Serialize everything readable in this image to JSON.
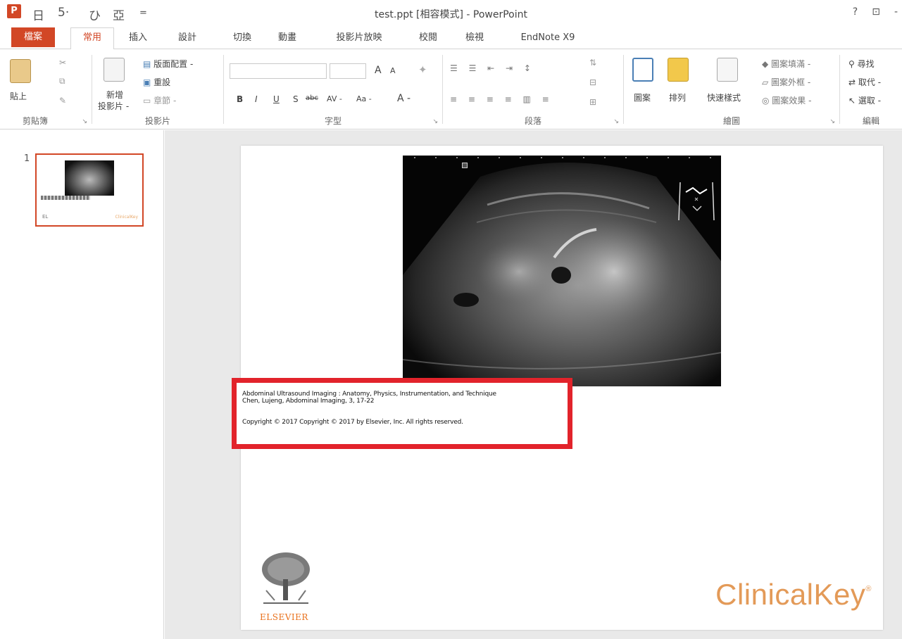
{
  "titlebar": {
    "title": "test.ppt [相容模式] - PowerPoint",
    "qa_app": "P",
    "qa_save": "日",
    "qa_undo": "5·",
    "qa_redo": "ひ",
    "qa_present": "亞",
    "qa_customize": "=",
    "help": "?",
    "display_options": "⊡",
    "minimize": "-"
  },
  "tabs": [
    {
      "label": "檔案"
    },
    {
      "label": "常用"
    },
    {
      "label": "插入"
    },
    {
      "label": "設計"
    },
    {
      "label": "切換"
    },
    {
      "label": "動畫"
    },
    {
      "label": "投影片放映"
    },
    {
      "label": "校閱"
    },
    {
      "label": "檢視"
    },
    {
      "label": "EndNote X9"
    }
  ],
  "ribbon": {
    "clipboard": {
      "label": "剪貼簿",
      "paste": "貼上"
    },
    "slides": {
      "label": "投影片",
      "new_slide_1": "新增",
      "new_slide_2": "投影片 -",
      "layout": "版面配置 -",
      "reset": "重設",
      "section": "章節 -"
    },
    "font": {
      "label": "字型",
      "bold": "B",
      "italic": "I",
      "underline": "U",
      "shadow": "S",
      "strike": "abc",
      "spacing": "AV -",
      "case": "Aa -",
      "grow": "A",
      "shrink": "A",
      "color": "A -"
    },
    "paragraph": {
      "label": "段落"
    },
    "drawing": {
      "label": "繪圖",
      "shapes": "圖案",
      "arrange": "排列",
      "quick_styles": "快速樣式",
      "fill": "圖案填滿 -",
      "outline": "圖案外框 -",
      "effects": "圖案效果 -"
    },
    "editing": {
      "label": "編輯",
      "find": "尋找",
      "replace": "取代 -",
      "select": "選取 -"
    }
  },
  "thumbnails": {
    "slide_number": "1",
    "logo_text": "EL",
    "ck_text": "ClinicalKey"
  },
  "slide": {
    "citation_line1": "Abdominal Ultrasound Imaging : Anatomy, Physics, Instrumentation, and Technique",
    "citation_line2": "Chen, Lujeng, Abdominal Imaging, 3, 17-22",
    "citation_line3": "Copyright © 2017  Copyright © 2017 by Elsevier, Inc. All rights reserved.",
    "elsevier": "ELSEVIER",
    "clinicalkey": "ClinicalKey",
    "clinicalkey_mark": "®"
  },
  "colors": {
    "accent": "#d24726",
    "highlight_border": "#e2232b",
    "clinicalkey": "#e39a58",
    "elsevier": "#e9711c"
  }
}
